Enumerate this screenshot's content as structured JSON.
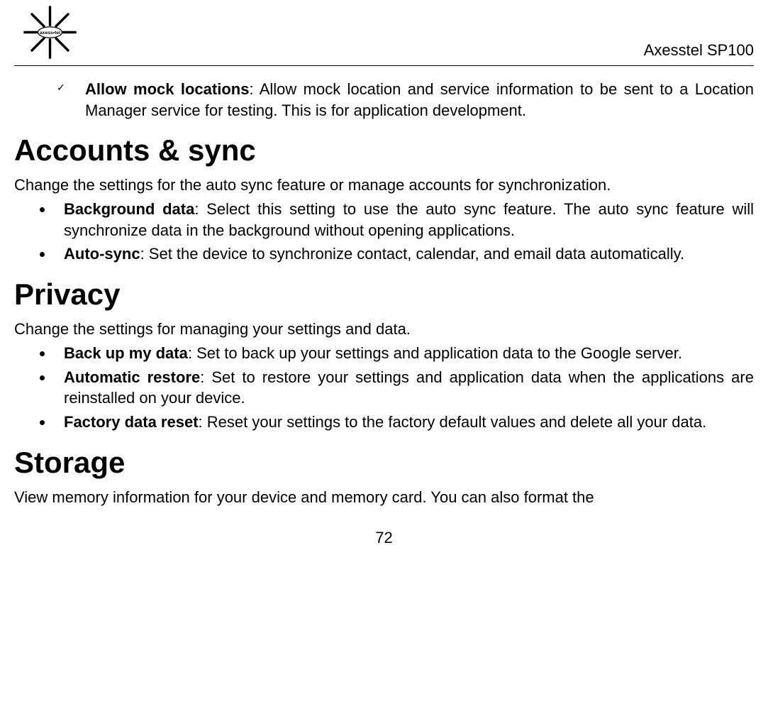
{
  "header": {
    "product": "Axesstel SP100",
    "logo_alt": "axess•tel"
  },
  "check_item": {
    "bold": "Allow mock locations",
    "text": ": Allow mock location and service information to be sent to a Location Manager service for testing. This is for application development."
  },
  "sections": [
    {
      "heading": "Accounts & sync",
      "intro": "Change the settings for the auto sync feature or manage accounts for synchronization.",
      "items": [
        {
          "bold": "Background data",
          "text": ": Select this setting to use the auto sync feature. The auto sync feature will synchronize data in the background without opening applications."
        },
        {
          "bold": "Auto-sync",
          "text": ": Set the device to synchronize contact, calendar, and email data automatically."
        }
      ]
    },
    {
      "heading": "Privacy",
      "intro": "Change the settings for managing your settings and data.",
      "items": [
        {
          "bold": "Back up my data",
          "text": ": Set to back up your settings and application data to the Google server."
        },
        {
          "bold": "Automatic restore",
          "text": ": Set to restore your settings and application data when the applications are reinstalled on your device."
        },
        {
          "bold": "Factory data reset",
          "text": ": Reset your settings to the factory default values and delete all your data."
        }
      ]
    },
    {
      "heading": "Storage",
      "intro": "View memory information for your device and memory card. You can also format the",
      "items": []
    }
  ],
  "page_number": "72"
}
